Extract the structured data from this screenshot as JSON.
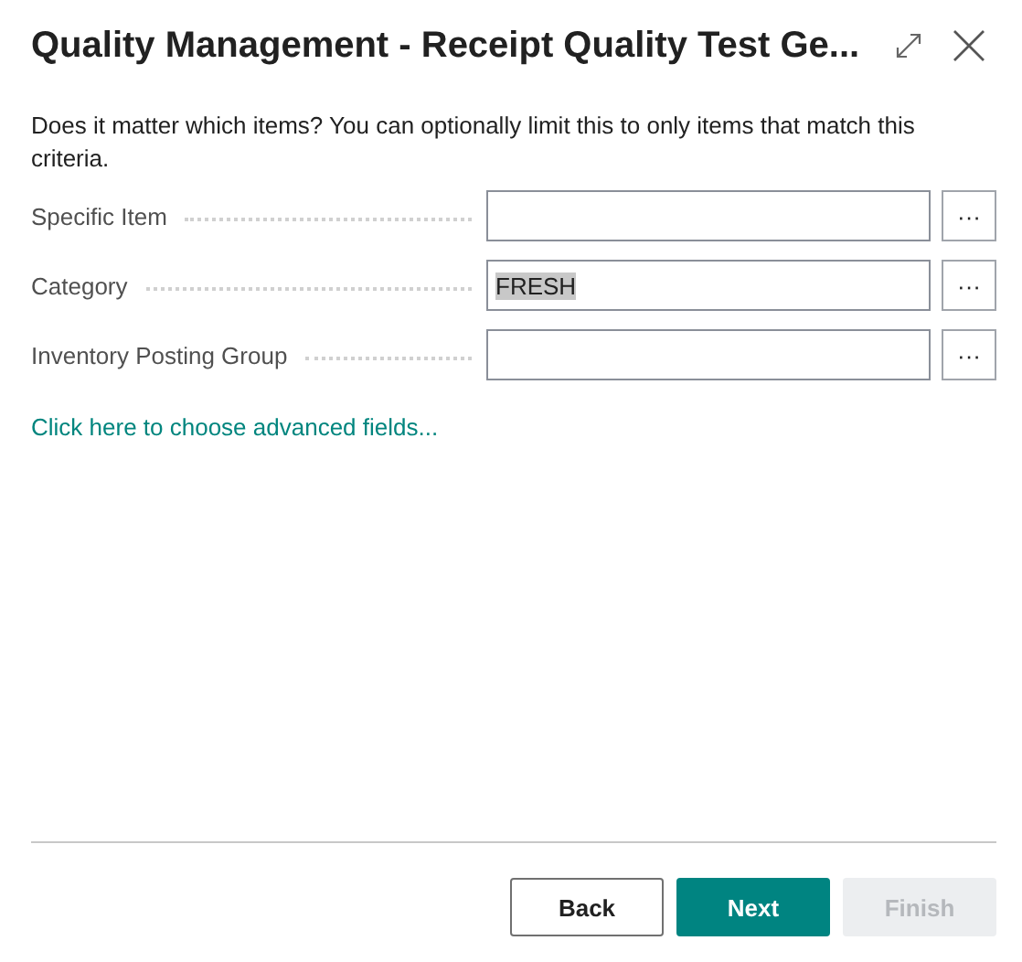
{
  "window": {
    "title": "Quality Management - Receipt Quality Test Ge..."
  },
  "description": "Does it matter which items? You can optionally limit this to only items that match this criteria.",
  "fields": [
    {
      "label": "Specific Item",
      "lookup": "···"
    },
    {
      "label": "Category",
      "value": "FRESH",
      "value_selected": true,
      "lookup": "···"
    },
    {
      "label": "Inventory Posting Group",
      "lookup": "···"
    }
  ],
  "advanced_link": "Click here to choose advanced fields...",
  "buttons": [
    {
      "label": "Back",
      "kind": "secondary",
      "disabled": false
    },
    {
      "label": "Next",
      "kind": "primary",
      "disabled": false
    },
    {
      "label": "Finish",
      "kind": "secondary",
      "disabled": true
    }
  ]
}
